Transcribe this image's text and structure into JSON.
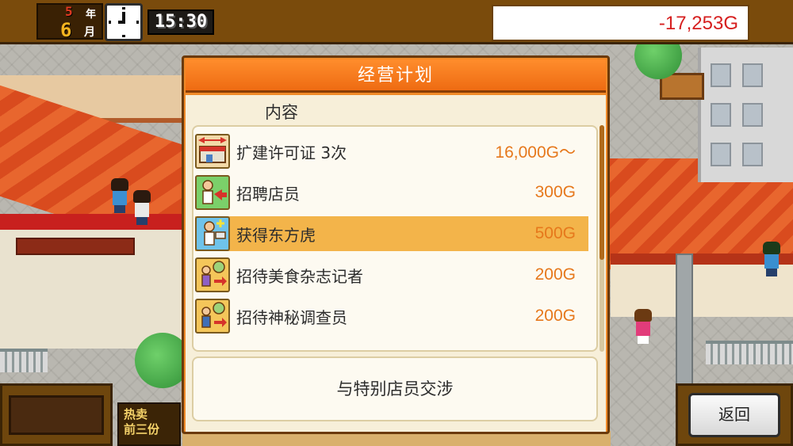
{
  "hud": {
    "year_value": "5",
    "year_label": "年",
    "month_value": "6",
    "month_label": "月",
    "time": "15:30",
    "money": "-17,253G"
  },
  "panel": {
    "title": "经营计划",
    "section_label": "内容",
    "items": [
      {
        "label": "扩建许可证 3次",
        "price": "16,000G～",
        "icon": "expansion-permit-icon"
      },
      {
        "label": "招聘店员",
        "price": "300G",
        "icon": "hire-staff-icon"
      },
      {
        "label": "获得东方虎",
        "price": "500G",
        "icon": "acquire-staff-icon"
      },
      {
        "label": "招待美食杂志记者",
        "price": "200G",
        "icon": "invite-food-reporter-icon"
      },
      {
        "label": "招待神秘调查员",
        "price": "200G",
        "icon": "invite-mystery-inspector-icon"
      }
    ],
    "selected_index": 2,
    "negotiate_label": "与特别店员交涉"
  },
  "bottom": {
    "bestseller_line1": "热卖",
    "bestseller_line2": "前三份",
    "back_label": "返回"
  },
  "colors": {
    "panel_orange": "#f08a28",
    "selected_row": "#f3b44a",
    "price_text": "#e6781c",
    "money_negative": "#d61f1f"
  }
}
